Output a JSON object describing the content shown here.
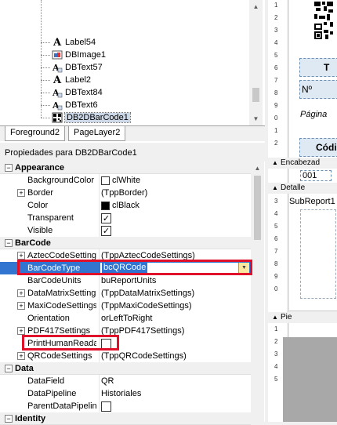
{
  "tree": {
    "items": [
      {
        "label": "Label54",
        "icon": "label-icon"
      },
      {
        "label": "DBImage1",
        "icon": "dbimage-icon"
      },
      {
        "label": "DBText57",
        "icon": "dbtext-icon"
      },
      {
        "label": "Label2",
        "icon": "label-icon"
      },
      {
        "label": "DBText84",
        "icon": "dbtext-icon"
      },
      {
        "label": "DBText6",
        "icon": "dbtext-icon"
      },
      {
        "label": "DB2DBarCode1",
        "icon": "barcode-icon"
      }
    ]
  },
  "tabs": [
    "Foreground2",
    "PageLayer2"
  ],
  "props_title": "Propiedades para DB2DBarCode1",
  "categories": {
    "appearance": "Appearance",
    "barcode": "BarCode",
    "data": "Data",
    "identity": "Identity"
  },
  "props": {
    "background_color": {
      "name": "BackgroundColor",
      "value": "clWhite"
    },
    "border": {
      "name": "Border",
      "value": "(TppBorder)"
    },
    "color": {
      "name": "Color",
      "value": "clBlack"
    },
    "transparent": {
      "name": "Transparent",
      "checked": true
    },
    "visible": {
      "name": "Visible",
      "checked": true
    },
    "aztec": {
      "name": "AztecCodeSettings",
      "value": "(TppAztecCodeSettings)"
    },
    "barcode_type": {
      "name": "BarCodeType",
      "value": "bcQRCode"
    },
    "barcode_units": {
      "name": "BarCodeUnits",
      "value": "buReportUnits"
    },
    "datamatrix": {
      "name": "DataMatrixSettings",
      "value": "(TppDataMatrixSettings)"
    },
    "maxicode": {
      "name": "MaxiCodeSettings",
      "value": "(TppMaxiCodeSettings)"
    },
    "orientation": {
      "name": "Orientation",
      "value": "orLeftToRight"
    },
    "pdf417": {
      "name": "PDF417Settings",
      "value": "(TppPDF417Settings)"
    },
    "print_human": {
      "name": "PrintHumanReadable",
      "checked": false
    },
    "qrcode": {
      "name": "QRCodeSettings",
      "value": "(TppQRCodeSettings)"
    },
    "data_field": {
      "name": "DataField",
      "value": "QR"
    },
    "data_pipeline": {
      "name": "DataPipeline",
      "value": "Historiales"
    },
    "parent_pipeline": {
      "name": "ParentDataPipeline",
      "checked": false
    }
  },
  "colors": {
    "selection": "#3175d0",
    "highlight_box": "#e0102a",
    "white_swatch": "#ffffff",
    "black_swatch": "#000000"
  },
  "designer": {
    "ruler_ticks": [
      "1",
      "2",
      "3",
      "4",
      "5",
      "6",
      "7",
      "8",
      "9",
      "0",
      "1",
      "2",
      "3",
      "4",
      "5",
      "6",
      "7",
      "8",
      "9",
      "0",
      "1",
      "2",
      "3",
      "4",
      "5"
    ],
    "box_t": "T",
    "box_n": "Nº",
    "pagina": "Página",
    "codi": "Códi",
    "band_encabezado": "Encabezad",
    "encabezado_value": "001",
    "band_detalle": "Detalle",
    "subreport": "SubReport1",
    "band_pie": "Pie"
  }
}
